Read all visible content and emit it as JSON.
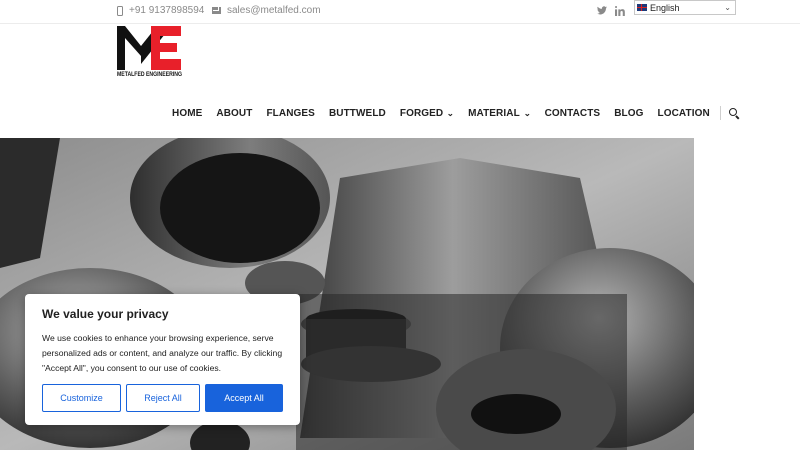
{
  "topbar": {
    "phone": "+91 9137898594",
    "email": "sales@metalfed.com",
    "social_icons": [
      "twitter-icon",
      "linkedin-icon"
    ],
    "language": "English"
  },
  "logo": {
    "caption": "METALFED ENGINEERING",
    "colors": {
      "black": "#111111",
      "red": "#e8202a"
    }
  },
  "nav": {
    "items": [
      {
        "label": "HOME"
      },
      {
        "label": "ABOUT"
      },
      {
        "label": "FLANGES"
      },
      {
        "label": "BUTTWELD"
      },
      {
        "label": "FORGED",
        "dropdown": true
      },
      {
        "label": "MATERIAL",
        "dropdown": true
      },
      {
        "label": "CONTACTS"
      },
      {
        "label": "BLOG"
      },
      {
        "label": "LOCATION"
      }
    ],
    "search_icon": "search-icon"
  },
  "cookie": {
    "title": "We value your privacy",
    "body": "We use cookies to enhance your browsing experience, serve personalized ads or content, and analyze our traffic. By clicking \"Accept All\", you consent to our use of cookies.",
    "customize": "Customize",
    "reject": "Reject All",
    "accept": "Accept All",
    "accent": "#1863dc"
  }
}
